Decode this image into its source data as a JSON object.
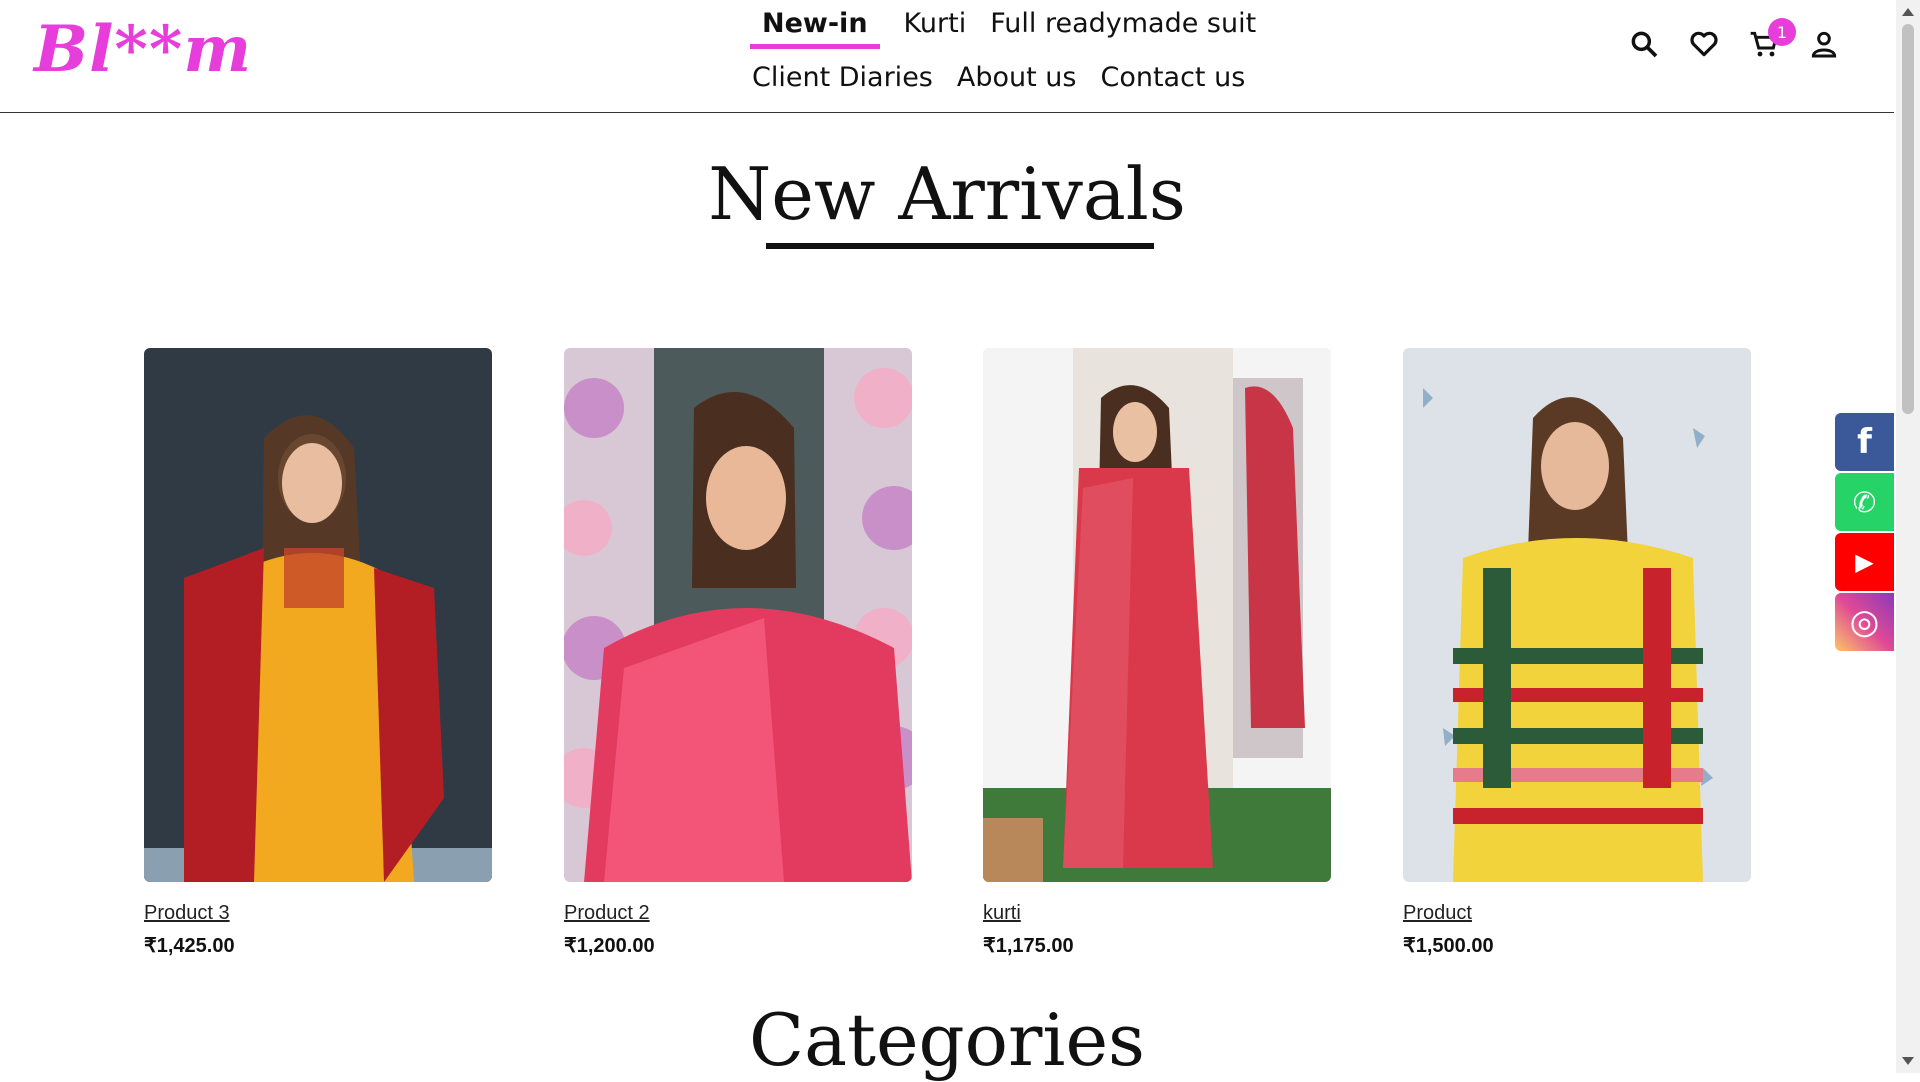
{
  "brand": {
    "logo_text": "Bl**m",
    "accent_color": "#e63ddb"
  },
  "nav": {
    "row1": [
      "New-in",
      "Kurti",
      "Full readymade suit"
    ],
    "row2": [
      "Client Diaries",
      "About us",
      "Contact us"
    ],
    "active": "New-in"
  },
  "header_icons": {
    "search": "search-icon",
    "wishlist": "heart-icon",
    "cart": "cart-icon",
    "cart_count": "1",
    "account": "user-icon"
  },
  "sections": {
    "new_arrivals_title": "New Arrivals",
    "categories_title": "Categories"
  },
  "products": [
    {
      "name": "Product 3",
      "price": "₹1,425.00",
      "palette": [
        "#2f3a44",
        "#f2a91f",
        "#b31e24"
      ]
    },
    {
      "name": "Product 2",
      "price": "₹1,200.00",
      "palette": [
        "#c98fc8",
        "#e23b5f",
        "#f0b0c8"
      ]
    },
    {
      "name": "kurti",
      "price": "₹1,175.00",
      "palette": [
        "#e8e3dc",
        "#d9394a",
        "#3f7a3a"
      ]
    },
    {
      "name": "Product",
      "price": "₹1,500.00",
      "palette": [
        "#dde2e8",
        "#f3d33b",
        "#2c5b3a"
      ]
    }
  ],
  "social": [
    {
      "name": "facebook",
      "glyph": "f",
      "color": "#3b5998"
    },
    {
      "name": "whatsapp",
      "glyph": "✆",
      "color": "#25d366"
    },
    {
      "name": "youtube",
      "glyph": "▶",
      "color": "#ff0000"
    },
    {
      "name": "instagram",
      "glyph": "◎",
      "color": "#d6249f"
    }
  ]
}
